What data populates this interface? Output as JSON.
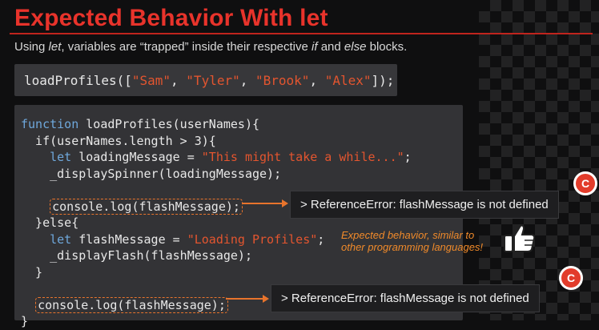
{
  "slide": {
    "title": "Expected Behavior With let",
    "subtitle": {
      "p1": "Using ",
      "let": "let",
      "p2": ", variables are “trapped” inside their respective ",
      "if": "if",
      "p3": " and ",
      "else": "else",
      "p4": " blocks."
    }
  },
  "call_line": {
    "fn": "loadProfiles([",
    "s1": "\"Sam\"",
    "c1": ", ",
    "s2": "\"Tyler\"",
    "c2": ", ",
    "s3": "\"Brook\"",
    "c3": ", ",
    "s4": "\"Alex\"",
    "end": "]);"
  },
  "code": {
    "l1_kw": "function",
    "l1_rest": " loadProfiles(userNames){",
    "l2": "  if(userNames.length > 3){",
    "l3_indent": "    ",
    "l3_kw": "let",
    "l3_mid": " loadingMessage = ",
    "l3_str": "\"This might take a while...\"",
    "l3_end": ";",
    "l4": "    _displaySpinner(loadingMessage);",
    "l6_indent": "    ",
    "l6_code": "console.log(flashMessage);",
    "l7": "  }else{",
    "l8_indent": "    ",
    "l8_kw": "let",
    "l8_mid": " flashMessage = ",
    "l8_str": "\"Loading Profiles\"",
    "l8_end": ";",
    "l9": "    _displayFlash(flashMessage);",
    "l10": "  }",
    "l12_indent": "  ",
    "l12_code": "console.log(flashMessage);",
    "l13": "}"
  },
  "errors": {
    "e1": "> ReferenceError: flashMessage is not defined",
    "e2": "> ReferenceError: flashMessage is not defined"
  },
  "annotation": {
    "l1": "Expected behavior, similar to",
    "l2": "other programming languages!"
  },
  "badge_letter": "C",
  "colors": {
    "accent": "#e8332b",
    "keyword": "#6fa8dc",
    "string": "#e3552f",
    "arrow": "#e8742c"
  }
}
